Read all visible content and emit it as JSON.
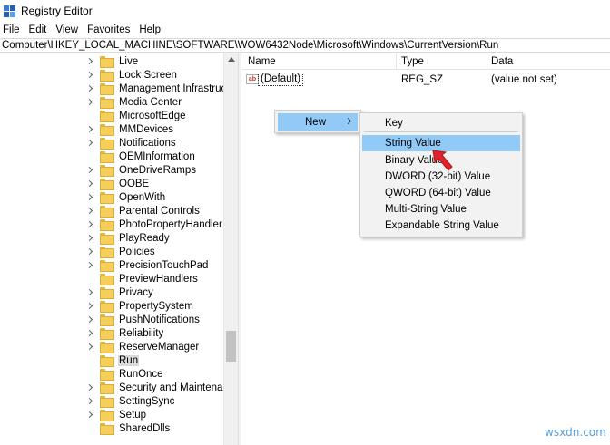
{
  "window": {
    "title": "Registry Editor"
  },
  "menubar": {
    "items": [
      "File",
      "Edit",
      "View",
      "Favorites",
      "Help"
    ]
  },
  "address": {
    "path": "Computer\\HKEY_LOCAL_MACHINE\\SOFTWARE\\WOW6432Node\\Microsoft\\Windows\\CurrentVersion\\Run"
  },
  "tree": {
    "items": [
      {
        "label": "Live",
        "expandable": true
      },
      {
        "label": "Lock Screen",
        "expandable": true
      },
      {
        "label": "Management Infrastructure",
        "expandable": true
      },
      {
        "label": "Media Center",
        "expandable": true
      },
      {
        "label": "MicrosoftEdge",
        "expandable": false
      },
      {
        "label": "MMDevices",
        "expandable": true
      },
      {
        "label": "Notifications",
        "expandable": true
      },
      {
        "label": "OEMInformation",
        "expandable": false
      },
      {
        "label": "OneDriveRamps",
        "expandable": true
      },
      {
        "label": "OOBE",
        "expandable": true
      },
      {
        "label": "OpenWith",
        "expandable": true
      },
      {
        "label": "Parental Controls",
        "expandable": true
      },
      {
        "label": "PhotoPropertyHandler",
        "expandable": true
      },
      {
        "label": "PlayReady",
        "expandable": true
      },
      {
        "label": "Policies",
        "expandable": true
      },
      {
        "label": "PrecisionTouchPad",
        "expandable": true
      },
      {
        "label": "PreviewHandlers",
        "expandable": false
      },
      {
        "label": "Privacy",
        "expandable": true
      },
      {
        "label": "PropertySystem",
        "expandable": true
      },
      {
        "label": "PushNotifications",
        "expandable": true
      },
      {
        "label": "Reliability",
        "expandable": true
      },
      {
        "label": "ReserveManager",
        "expandable": true
      },
      {
        "label": "Run",
        "expandable": false,
        "selected": true
      },
      {
        "label": "RunOnce",
        "expandable": false
      },
      {
        "label": "Security and Maintenance",
        "expandable": true
      },
      {
        "label": "SettingSync",
        "expandable": true
      },
      {
        "label": "Setup",
        "expandable": true
      },
      {
        "label": "SharedDlls",
        "expandable": false
      }
    ]
  },
  "list": {
    "columns": {
      "name": "Name",
      "type": "Type",
      "data": "Data"
    },
    "rows": [
      {
        "icon": "ab",
        "name": "(Default)",
        "type": "REG_SZ",
        "data": "(value not set)"
      }
    ]
  },
  "context_menu": {
    "new_label": "New"
  },
  "submenu": {
    "items": [
      "Key",
      "String Value",
      "Binary Value",
      "DWORD (32-bit) Value",
      "QWORD (64-bit) Value",
      "Multi-String Value",
      "Expandable String Value"
    ],
    "highlighted": "String Value"
  },
  "colors": {
    "highlight": "#91c9f7",
    "selection": "#d9d9d9",
    "folder": "#f5cf5a",
    "arrow": "#e0222a"
  },
  "watermark": "wsxdn.com"
}
